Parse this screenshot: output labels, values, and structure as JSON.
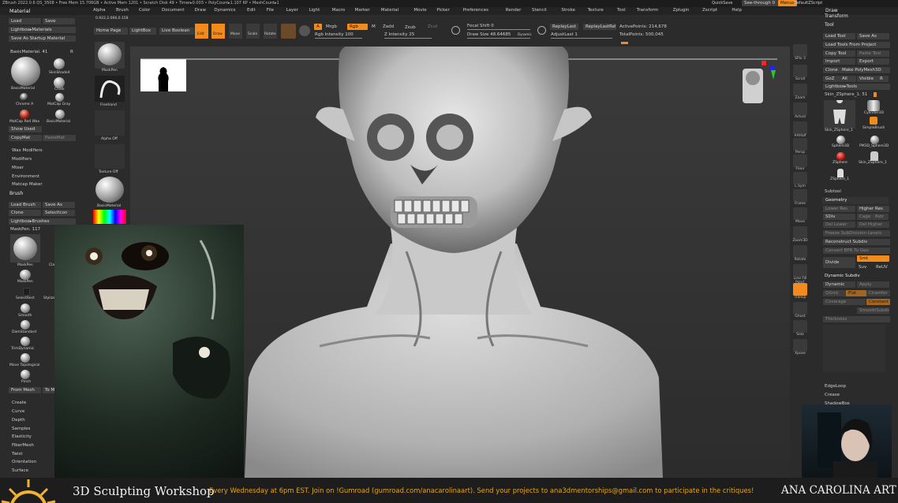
{
  "titlebar": {
    "left": "ZBrush 2022.0.6   QS_3508  • Free Mem 15.706GB • Active Mem 1201 • Scratch Disk 49 • Timer▸0.003 • PolyCount▸1.107 KP • MeshCount▸1",
    "quicksave": "QuickSave",
    "seethrough": "See-through  0",
    "menus_btn": "Menus",
    "default_script": "DefaultZScript"
  },
  "menubar": [
    "Alpha",
    "Brush",
    "Color",
    "Document",
    "Draw",
    "Dynamics",
    "Edit",
    "File",
    "Layer",
    "Light",
    "Macro",
    "Marker",
    "Material",
    "Movie",
    "Picker",
    "Preferences",
    "Render",
    "Stencil",
    "Stroke",
    "Texture",
    "Tool",
    "Transform",
    "Zplugin",
    "Zscript",
    "Help"
  ],
  "left_panel": {
    "material_title": "Material",
    "load": "Load",
    "save": "Save",
    "lightbox_materials": "Lightbox▸Materials",
    "save_startup": "Save As Startup Material",
    "basic_material": "BasicMaterial. 41",
    "r": "R",
    "materials": [
      "BasicMaterial",
      "SkinShade4",
      "Chalk",
      "Chrome A",
      "MatCap Gray",
      "MatCap Red Wax",
      "BasicMaterial"
    ],
    "show_used": "Show Used",
    "copymat": "CopyMat",
    "pastemat": "PasteMat",
    "mat_sections": [
      "Wax Modifiers",
      "Modifiers",
      "Mixer",
      "Environment",
      "Matcap Maker"
    ],
    "brush_title": "Brush",
    "load_brush": "Load Brush",
    "save_as": "Save As",
    "clone": "Clone",
    "select_icon": "SelectIcon",
    "lightbox_brushes": "Lightbox▸Brushes",
    "maskpen_count": "MaskPen. 117",
    "brushes": [
      "MaskPen",
      "Clay",
      "MaskPen",
      "SelectRect",
      "Stylize",
      "Smooth",
      "DamStandard",
      "TrimDynamic",
      "Move Topological",
      "Pinch"
    ],
    "from_mesh": "From Mesh",
    "to_mesh": "To Mesh",
    "brush_sections": [
      "Create",
      "Curve",
      "Depth",
      "Samples",
      "Elasticity",
      "FiberMesh",
      "Twist",
      "Orientation",
      "Surface"
    ]
  },
  "shelf": {
    "home_page": "Home Page",
    "lightbox": "LightBox",
    "live_boolean": "Live Boolean",
    "edit": "Edit",
    "draw": "Draw",
    "move": "Move",
    "scale": "Scale",
    "rotate": "Rotate",
    "a": "A",
    "mrgb": "Mrgb",
    "rgb": "Rgb",
    "m": "M",
    "zadd": "Zadd",
    "zsub": "Zsub",
    "zcut": "Zcut",
    "rgb_intensity": "Rgb Intensity 100",
    "z_intensity": "Z Intensity 25",
    "focal_shift": "Focal Shift 0",
    "draw_size": "Draw Size 48.64685",
    "dynamic": "Dynamic",
    "replay_last": "ReplayLast",
    "replay_last_rel": "ReplayLastRel",
    "adjust_last": "AdjustLast 1",
    "active_points": "ActivePoints: 214,678",
    "total_points": "TotalPoints: 500,045",
    "coords": "0.922,2.066,0.158"
  },
  "brush_column": [
    "MaskPen",
    "Freehand",
    "Alpha Off",
    "Texture Off",
    "BasicMaterial"
  ],
  "right_icons": [
    "SPix 3",
    "Scroll",
    "Zoom",
    "Actual",
    "AAHalf",
    "Persp",
    "Floor",
    "L.Sym",
    "Frame",
    "Move",
    "Zoom3D",
    "Rotate",
    "Line Fill PolyF",
    "Transp",
    "Ghost",
    "Solo",
    "Xpose"
  ],
  "tool_panel": {
    "draw": "Draw",
    "transform": "Transform",
    "tool": "Tool",
    "load_tool": "Load Tool",
    "save_as": "Save As",
    "load_from_project": "Load Tools From Project",
    "copy_tool": "Copy Tool",
    "paste_tool": "Paste Tool",
    "import": "Import",
    "export": "Export",
    "clone": "Clone",
    "make_polymesh": "Make PolyMesh3D",
    "goz": "GoZ",
    "all": "All",
    "visible": "Visible",
    "r": "R",
    "lightbox_tools": "Lightbox▸Tools",
    "skin_zsphere": "Skin_ZSphere_1. 51",
    "tools": [
      "Skin_ZSphere_1",
      "Cylinder3D",
      "SimpleBrush",
      "Sphere3D",
      "PM3D_Sphere3D",
      "ZSphere",
      "Skin_ZSphere_1",
      "ZSphere_1"
    ],
    "subtool": "Subtool",
    "geometry": "Geometry",
    "lower_res": "Lower Res",
    "higher_res": "Higher Res",
    "sdiv": "SDiv",
    "cage": "Cage",
    "rstr": "Rstr",
    "del_lower": "Del Lower",
    "del_higher": "Del Higher",
    "freeze_subdiv": "Freeze SubDivision Levels",
    "reconstruct_subdiv": "Reconstruct Subdiv",
    "convert_bpr": "Convert BPR To Geo",
    "divide": "Divide",
    "smt": "Smt",
    "suv": "Suv",
    "reuv": "ReUV",
    "dynamic_subdiv": "Dynamic Subdiv",
    "dynamic": "Dynamic",
    "apply": "Apply",
    "qgrid": "QGrid",
    "flat": "Flat",
    "chamfer": "Chamfer",
    "coverage": "Coverage",
    "constant": "Constant",
    "smooth_subdiv": "SmoothSubdiv",
    "thickness": "Thickness",
    "edge_loop": "EdgeLoop",
    "crease": "Crease",
    "shadowbox": "ShadowBox"
  },
  "banner": {
    "title": "3D Sculpting Workshop",
    "message": "Every Wednesday at 6pm EST. Join on !Gumroad (gumroad.com/anacarolinaart). Send your projects to ana3dmentorships@gmail.com to participate in the critiques!",
    "brand": "ANA CAROLINA ART"
  },
  "colors": {
    "accent": "#f28b1e",
    "panel": "#2b2b2b",
    "button": "#3e3e3e",
    "banner": "#1f1f1f",
    "banner_text": "#e0a526"
  }
}
